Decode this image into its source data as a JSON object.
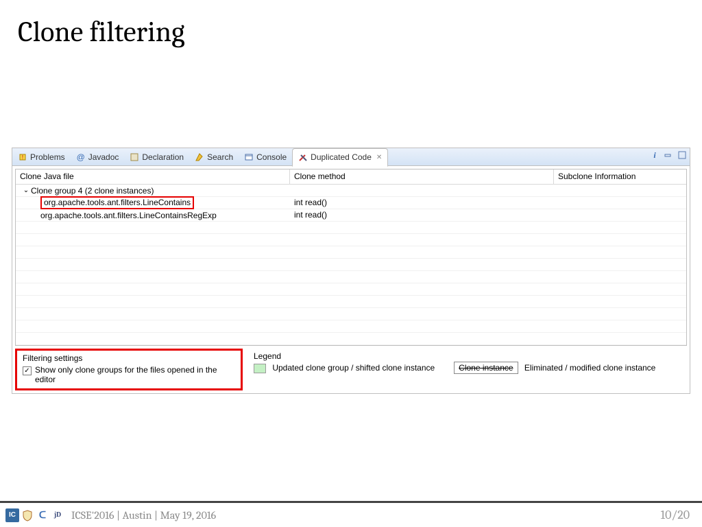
{
  "slide": {
    "title": "Clone filtering",
    "footer_text": "ICSE'2016 | Austin | May 19, 2016",
    "page_current": "10",
    "page_total": "/20"
  },
  "tabs": {
    "problems": "Problems",
    "javadoc": "Javadoc",
    "declaration": "Declaration",
    "search": "Search",
    "console": "Console",
    "duplicated": "Duplicated Code"
  },
  "columns": {
    "file": "Clone Java file",
    "method": "Clone method",
    "sub": "Subclone Information"
  },
  "rows": {
    "group_label": "Clone group 4 (2 clone instances)",
    "r1_file": "org.apache.tools.ant.filters.LineContains",
    "r1_method": "int read()",
    "r2_file": "org.apache.tools.ant.filters.LineContainsRegExp",
    "r2_method": "int read()"
  },
  "filtering": {
    "title": "Filtering settings",
    "checkbox_label": "Show only clone groups for the files opened in the editor",
    "checked_glyph": "✓"
  },
  "legend": {
    "title": "Legend",
    "updated": "Updated clone group / shifted clone instance",
    "strike": "Clone instance",
    "eliminated": "Eliminated / modified clone instance"
  }
}
